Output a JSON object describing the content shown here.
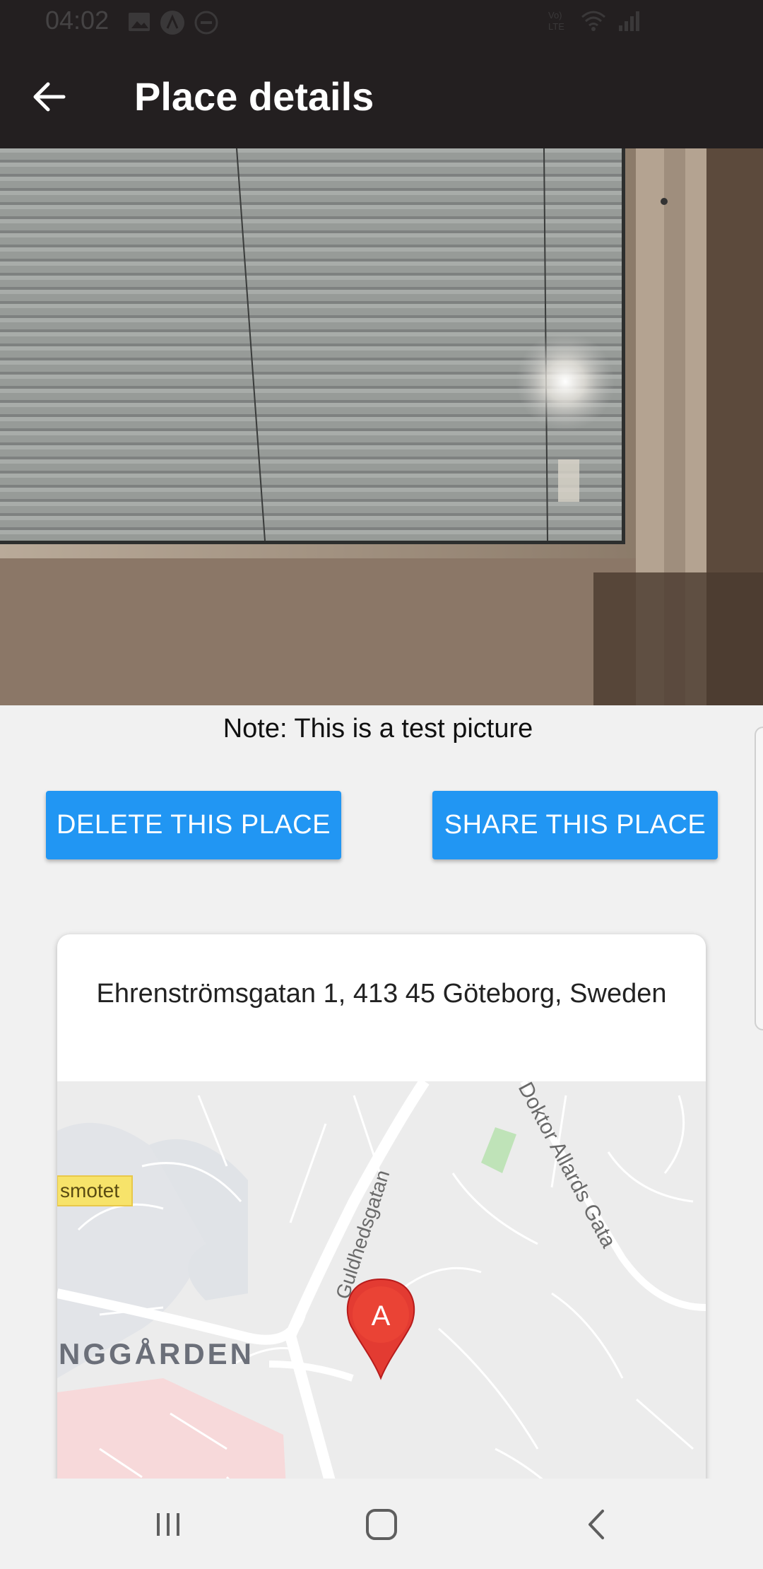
{
  "status_bar": {
    "time": "04:02",
    "left_icons": [
      "image-icon",
      "app-a-icon",
      "dnd-icon"
    ],
    "right_icons": [
      "volte-icon",
      "wifi-icon",
      "signal-icon"
    ]
  },
  "app_bar": {
    "title": "Place details",
    "back_icon": "arrow-left-icon"
  },
  "photo": {
    "description_icon": "photo-window-blinds"
  },
  "note": "Note: This is a test picture",
  "buttons": {
    "delete_label": "DELETE THIS PLACE",
    "share_label": "SHARE THIS PLACE",
    "color": "#2196f3"
  },
  "card": {
    "address": "Ehrenströmsgatan 1, 413 45 Göteborg, Sweden",
    "map": {
      "labels": {
        "poi": "smotet",
        "district": "NGGÅRDEN",
        "street1": "Guldhedsgatan",
        "street2": "Doktor Allards Gata"
      },
      "marker_label": "A",
      "marker_color": "#e53935"
    }
  },
  "nav_bar": {
    "recents_icon": "recents-icon",
    "home_icon": "home-icon",
    "back_icon": "chevron-left-icon"
  }
}
